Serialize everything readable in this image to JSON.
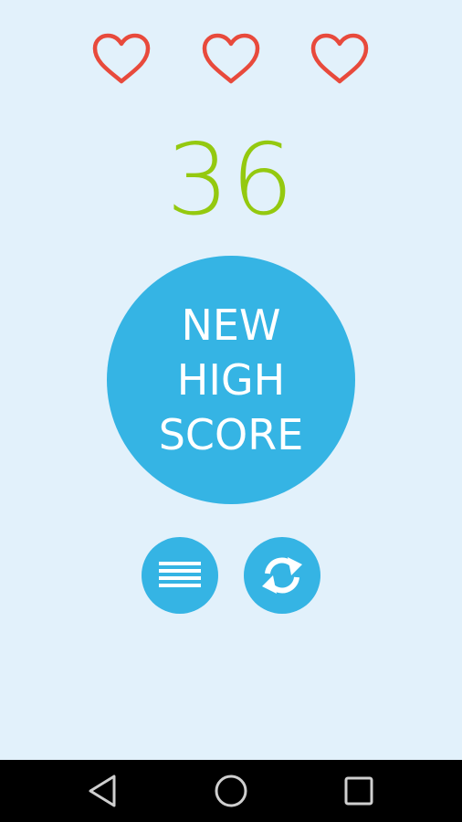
{
  "game": {
    "lives": [
      {
        "icon": "heart-outline-icon",
        "color": "#e84a3c"
      },
      {
        "icon": "heart-outline-icon",
        "color": "#e84a3c"
      },
      {
        "icon": "heart-outline-icon",
        "color": "#e84a3c"
      }
    ],
    "score": "36",
    "score_color": "#94c90f",
    "badge": {
      "lines": [
        "NEW",
        "HIGH",
        "SCORE"
      ],
      "color": "#35b4e4"
    },
    "buttons": {
      "menu_icon": "menu-icon",
      "restart_icon": "restart-icon",
      "color": "#35b4e4"
    }
  },
  "navbar": {
    "back_icon": "back-icon",
    "home_icon": "home-icon",
    "recents_icon": "recents-icon"
  },
  "colors": {
    "background": "#e2f1fb",
    "navbar": "#000000"
  }
}
